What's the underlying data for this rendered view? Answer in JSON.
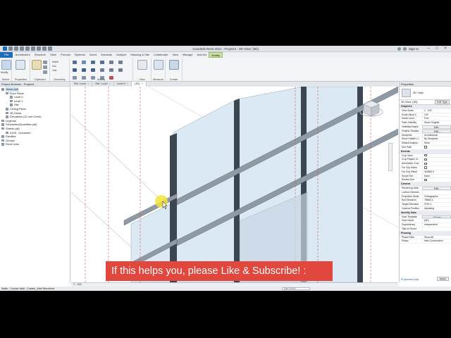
{
  "window": {
    "title": "Autodesk Revit 2021 - Project4 - 3D View: {3D}",
    "sign_in": "Sign In"
  },
  "ribbon": {
    "tabs": [
      "File",
      "Architecture",
      "Structure",
      "Steel",
      "Precast",
      "Systems",
      "Insert",
      "Annotate",
      "Analyze",
      "Massing & Site",
      "Collaborate",
      "View",
      "Manage",
      "Add-Ins",
      "Modify"
    ],
    "active_tab": "Modify",
    "groups": [
      "Select",
      "Properties",
      "Clipboard",
      "Geometry",
      "Modify",
      "View",
      "Measure",
      "Create"
    ],
    "select_label": "Select",
    "modify_btn": "Modify",
    "properties_label": "Properties",
    "notch_label": "Notch",
    "cut_label": "Cut",
    "join_label": "Join"
  },
  "project_browser": {
    "title": "Project Browser - Project4",
    "items": [
      {
        "label": "Views (all)",
        "indent": 0,
        "selected": true
      },
      {
        "label": "Floor Plans",
        "indent": 1
      },
      {
        "label": "Level 0",
        "indent": 2
      },
      {
        "label": "Level 1",
        "indent": 2
      },
      {
        "label": "Site",
        "indent": 2
      },
      {
        "label": "Ceiling Plans",
        "indent": 1
      },
      {
        "label": "3D Views",
        "indent": 1
      },
      {
        "label": "Elevations (12 mm Circle)",
        "indent": 1
      },
      {
        "label": "Legends",
        "indent": 0
      },
      {
        "label": "Schedules/Quantities (all)",
        "indent": 0
      },
      {
        "label": "Sheets (all)",
        "indent": 0
      },
      {
        "label": "A100 - Unnamed",
        "indent": 1
      },
      {
        "label": "Families",
        "indent": 0
      },
      {
        "label": "Groups",
        "indent": 0
      },
      {
        "label": "Revit Links",
        "indent": 0
      }
    ]
  },
  "view_tabs": [
    {
      "label": "Ref. Level",
      "active": false
    },
    {
      "label": "Ref. Level",
      "active": false
    },
    {
      "label": "Level 0",
      "active": false
    },
    {
      "label": "{3D}",
      "active": true
    }
  ],
  "properties": {
    "title": "Properties",
    "type_name": "3D View",
    "filter": "3D View: {3D}",
    "edit_type": "Edit Type",
    "sections": [
      {
        "name": "Graphics",
        "rows": [
          {
            "k": "View Scale",
            "v": "1 : 100"
          },
          {
            "k": "Scale Value 1:",
            "v": "100"
          },
          {
            "k": "Detail Level",
            "v": "Fine"
          },
          {
            "k": "Parts Visibility",
            "v": "Show Original"
          },
          {
            "k": "Visibility/Graphi...",
            "v": "Edit...",
            "btn": true
          },
          {
            "k": "Graphic Display...",
            "v": "Edit...",
            "btn": true
          },
          {
            "k": "Discipline",
            "v": "Architectural"
          },
          {
            "k": "Show Hidden Li...",
            "v": "By Discipline"
          },
          {
            "k": "Default Analysi...",
            "v": "None"
          },
          {
            "k": "Sun Path",
            "v": "",
            "check": true
          }
        ]
      },
      {
        "name": "Extents",
        "rows": [
          {
            "k": "Crop View",
            "v": "",
            "check": true
          },
          {
            "k": "Crop Region Vi...",
            "v": "",
            "check": true
          },
          {
            "k": "Annotation Crop",
            "v": "",
            "check": true
          },
          {
            "k": "Far Clip Active",
            "v": "",
            "check": true
          },
          {
            "k": "Far Clip Offset",
            "v": "304800.0"
          },
          {
            "k": "Scope Box",
            "v": "None"
          },
          {
            "k": "Section Box",
            "v": "",
            "check": true
          }
        ]
      },
      {
        "name": "Camera",
        "rows": [
          {
            "k": "Rendering Setti...",
            "v": "Edit...",
            "btn": true
          },
          {
            "k": "Locked Orientat...",
            "v": ""
          },
          {
            "k": "Projection Mode",
            "v": "Orthographic"
          },
          {
            "k": "Eye Elevation",
            "v": "78654.4"
          },
          {
            "k": "Target Elevation",
            "v": "3700.1"
          },
          {
            "k": "Camera Position",
            "v": "Adjusting"
          }
        ]
      },
      {
        "name": "Identity Data",
        "rows": [
          {
            "k": "View Template",
            "v": "<None>",
            "btn": true
          },
          {
            "k": "View Name",
            "v": "{3D}"
          },
          {
            "k": "Dependency",
            "v": "Independent"
          },
          {
            "k": "Title on Sheet",
            "v": ""
          }
        ]
      },
      {
        "name": "Phasing",
        "rows": [
          {
            "k": "Phase Filter",
            "v": "Show All"
          },
          {
            "k": "Phase",
            "v": "New Construction"
          }
        ]
      }
    ],
    "help_link": "Properties help",
    "apply": "Apply"
  },
  "scale_bar": "1 : 100",
  "status": {
    "text": "Walls : Curtain Wall : Curtain_Wall Storefront",
    "main_model": "Main Model"
  },
  "banner": "If this helps you, please Like & Subscribe! :",
  "colors": {
    "accent": "#1e6bb8",
    "active_tab": "#cbe3a2",
    "banner": "#e2473d",
    "glass": "#dbe9f5",
    "mullion": "#3b4652",
    "cursor": "#f2e43a"
  }
}
